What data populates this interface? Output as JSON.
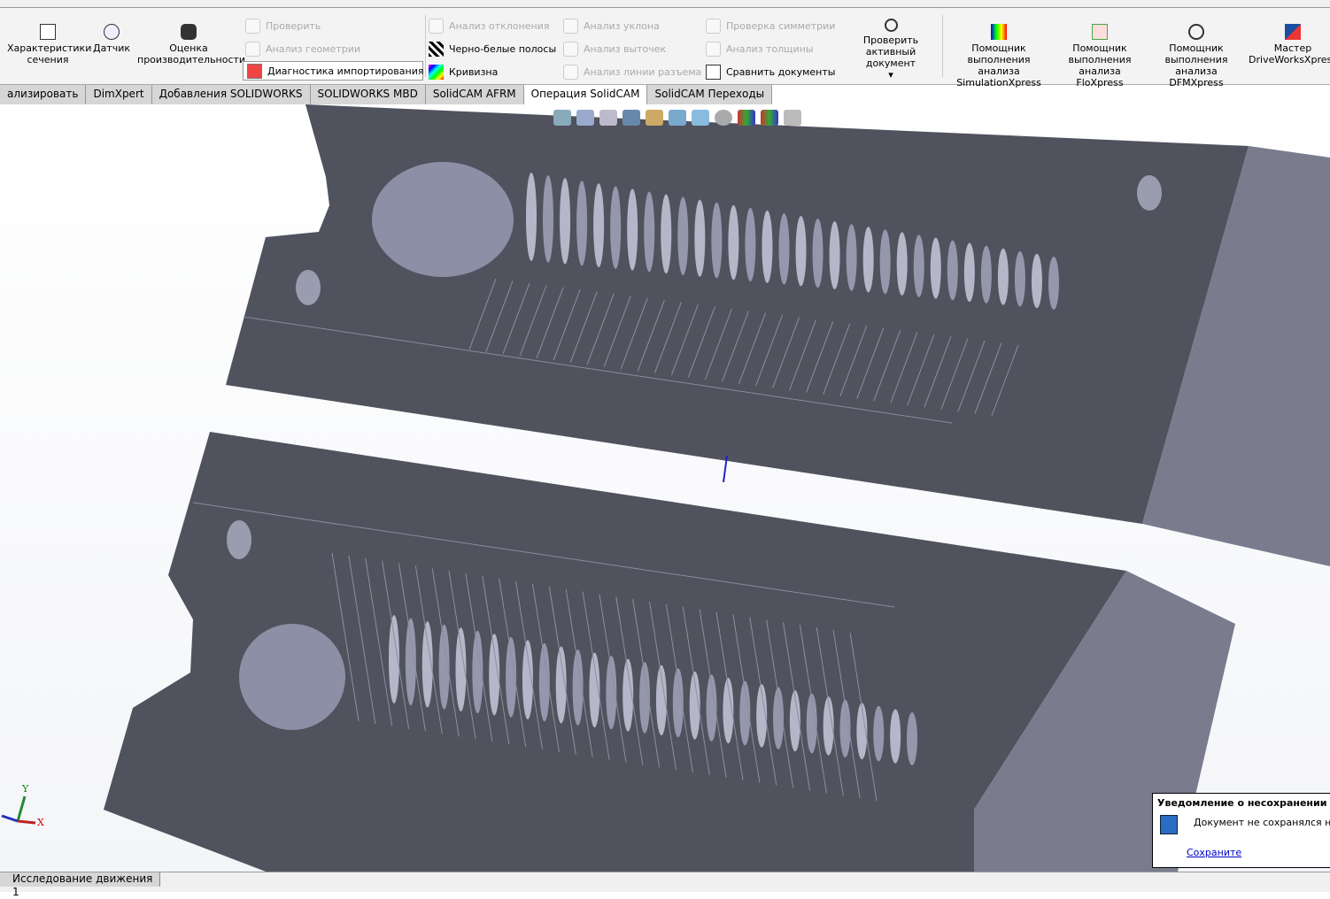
{
  "ribbon": {
    "big_buttons": [
      {
        "label": "Характеристики сечения",
        "icon": "section-properties-icon"
      },
      {
        "label": "Датчик",
        "icon": "sensor-icon"
      },
      {
        "label": "Оценка производительности",
        "icon": "performance-evaluation-icon"
      }
    ],
    "col1": [
      {
        "label": "Проверить",
        "enabled": false,
        "icon": "check-icon"
      },
      {
        "label": "Анализ геометрии",
        "enabled": false,
        "icon": "geometry-analysis-icon"
      },
      {
        "label": "Диагностика импортирования",
        "enabled": true,
        "icon": "import-diagnostics-icon"
      }
    ],
    "col2": [
      {
        "label": "Анализ отклонения",
        "enabled": false,
        "icon": "deviation-analysis-icon"
      },
      {
        "label": "Черно-белые полосы",
        "enabled": true,
        "icon": "zebra-stripes-icon"
      },
      {
        "label": "Кривизна",
        "enabled": true,
        "icon": "curvature-icon"
      }
    ],
    "col3": [
      {
        "label": "Анализ уклона",
        "enabled": false,
        "icon": "draft-analysis-icon"
      },
      {
        "label": "Анализ выточек",
        "enabled": false,
        "icon": "undercut-analysis-icon"
      },
      {
        "label": "Анализ линии разъема",
        "enabled": false,
        "icon": "parting-line-analysis-icon"
      }
    ],
    "col4": [
      {
        "label": "Проверка симметрии",
        "enabled": false,
        "icon": "symmetry-check-icon"
      },
      {
        "label": "Анализ толщины",
        "enabled": false,
        "icon": "thickness-analysis-icon"
      },
      {
        "label": "Сравнить документы",
        "enabled": true,
        "icon": "compare-documents-icon"
      }
    ],
    "check_active": "Проверить активный документ",
    "xpress": [
      {
        "label": "Помощник выполнения анализа SimulationXpress",
        "icon": "simulationxpress-icon"
      },
      {
        "label": "Помощник выполнения анализа FloXpress",
        "icon": "floxpress-icon"
      },
      {
        "label": "Помощник выполнения анализа DFMXpress",
        "icon": "dfmxpress-icon"
      },
      {
        "label": "Мастер DriveWorksXpress",
        "icon": "driveworksxpress-icon"
      }
    ]
  },
  "tabs": [
    "ализировать",
    "DimXpert",
    "Добавления SOLIDWORKS",
    "SOLIDWORKS MBD",
    "SolidCAM AFRM",
    "Операция  SolidCAM",
    "SolidCAM Переходы"
  ],
  "active_tab": 5,
  "triad": {
    "x": "X",
    "y": "Y"
  },
  "status": {
    "motion_tab": "Исследование движения 1"
  },
  "notification": {
    "title": "Уведомление о несохранении доку",
    "message": "Документ не сохранялся не м",
    "link": "Сохраните "
  }
}
